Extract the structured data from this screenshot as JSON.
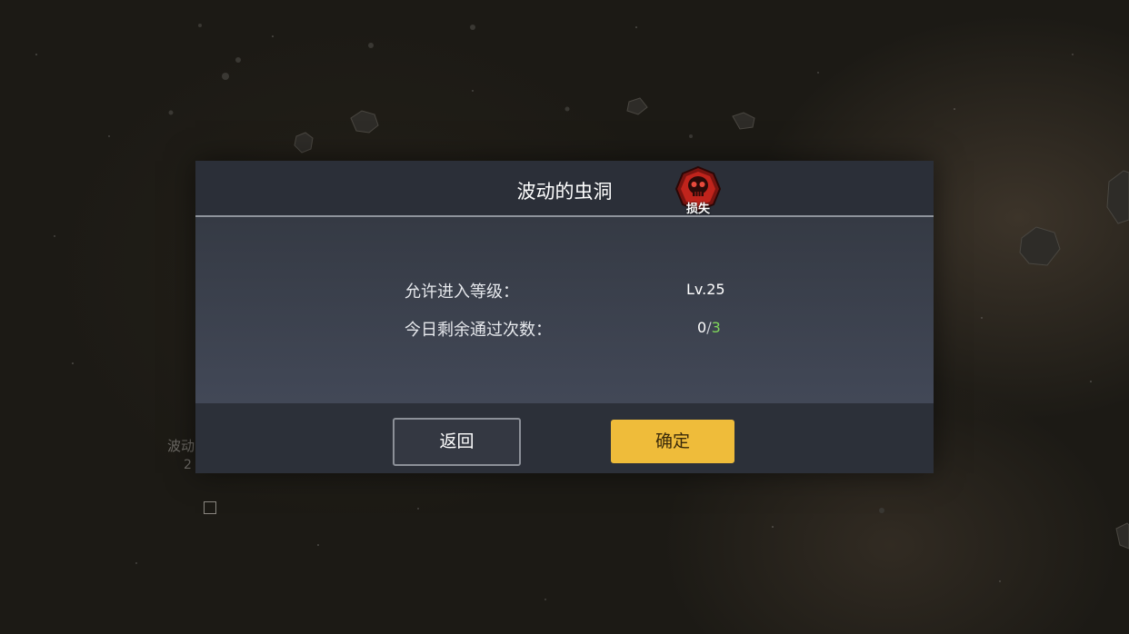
{
  "dialog": {
    "title": "波动的虫洞",
    "badge_label": "损失",
    "rows": [
      {
        "label": "允许进入等级：",
        "value": "Lv.25"
      },
      {
        "label": "今日剩余通过次数：",
        "current": "0",
        "separator": "/",
        "total": "3"
      }
    ],
    "back_label": "返回",
    "confirm_label": "确定"
  },
  "background": {
    "node_label": "波动",
    "node_sub": "2"
  },
  "colors": {
    "confirm_button": "#efbc3a",
    "count_total": "#7fd65a",
    "badge": "#c0241c"
  },
  "icons": {
    "badge_icon": "skull-icon"
  }
}
